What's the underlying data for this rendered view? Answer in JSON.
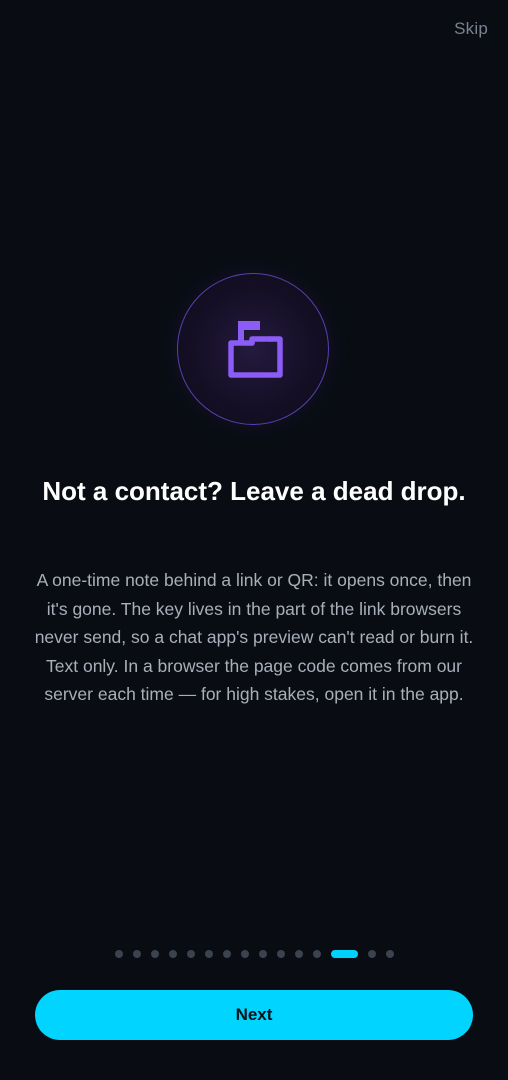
{
  "header": {
    "skip_label": "Skip"
  },
  "hero": {
    "icon": "mailbox-flag-icon",
    "accent_color": "#8b5cf6"
  },
  "slide": {
    "title": "Not a contact? Leave a dead drop.",
    "body": "A one-time note behind a link or QR: it opens once, then it's gone. The key lives in the part of the link browsers never send, so a chat app's preview can't read or burn it. Text only. In a browser the page code comes from our server each time — for high stakes, open it in the app."
  },
  "pagination": {
    "total": 15,
    "current": 13,
    "active_color": "#00d2ff"
  },
  "footer": {
    "next_label": "Next",
    "button_color": "#00d4ff"
  }
}
